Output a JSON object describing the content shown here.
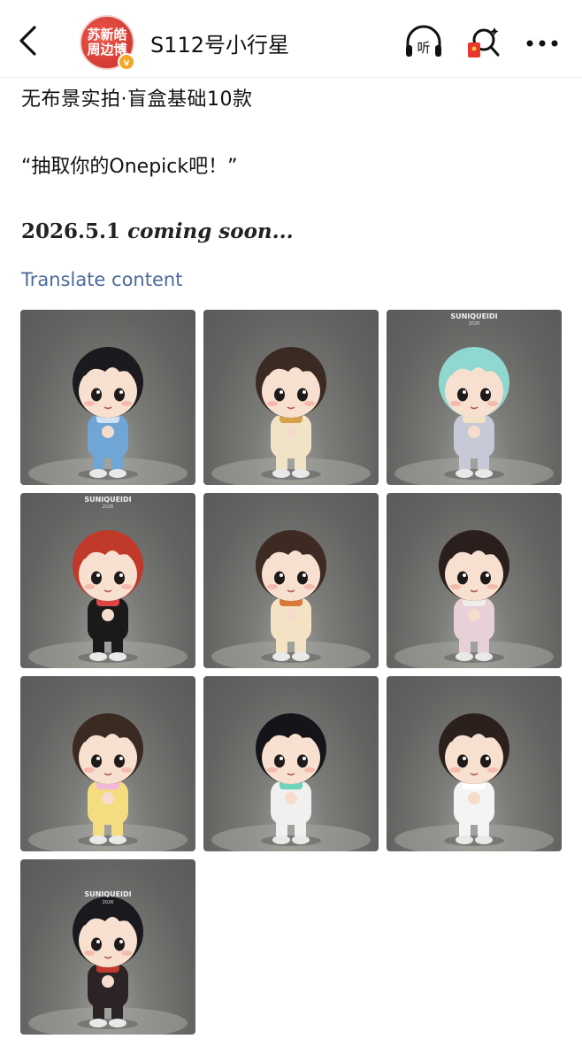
{
  "header": {
    "account_name": "S112号小行星",
    "avatar_text": "苏新皓周边博",
    "verified_badge": "v",
    "icons": [
      "back-arrow-icon",
      "headphones-listen-icon",
      "red-packet-search-icon",
      "more-icon"
    ],
    "listen_label": "听"
  },
  "post": {
    "line1": "无布景实拍·盲盒基础10款",
    "line2": "“抽取你的Onepick吧！”",
    "line3_date": "2026.5.1",
    "line3_rest": "coming soon...",
    "translate": "Translate content"
  },
  "images": {
    "count": 10,
    "logo_text": "SUNIQUEIDI",
    "logo_year": "2026",
    "figures": [
      {
        "hair": "#1b1b1f",
        "outfit": "#6fa6d6",
        "accent": "#cfe3f4",
        "label": "figure-1"
      },
      {
        "hair": "#3a2a23",
        "outfit": "#f1e4c6",
        "accent": "#d7a24a",
        "label": "figure-2"
      },
      {
        "hair": "#8fd8d0",
        "outfit": "#c7c9d6",
        "accent": "#f2e2c3",
        "label": "figure-3"
      },
      {
        "hair": "#c0392b",
        "outfit": "#1a1a1a",
        "accent": "#d44",
        "label": "figure-4"
      },
      {
        "hair": "#3d2a22",
        "outfit": "#f3e2c4",
        "accent": "#d97a3a",
        "label": "figure-5"
      },
      {
        "hair": "#2a1f1c",
        "outfit": "#e8d0d8",
        "accent": "#f1eee9",
        "label": "figure-6"
      },
      {
        "hair": "#3a2a22",
        "outfit": "#f4dc80",
        "accent": "#f3b8d8",
        "label": "figure-7"
      },
      {
        "hair": "#151519",
        "outfit": "#f0f0f0",
        "accent": "#6fd3bc",
        "label": "figure-8"
      },
      {
        "hair": "#2b201c",
        "outfit": "#f4f4f4",
        "accent": "#ffffff",
        "label": "figure-9"
      },
      {
        "hair": "#1a1a1e",
        "outfit": "#2b2325",
        "accent": "#c0392b",
        "label": "figure-10"
      }
    ]
  }
}
